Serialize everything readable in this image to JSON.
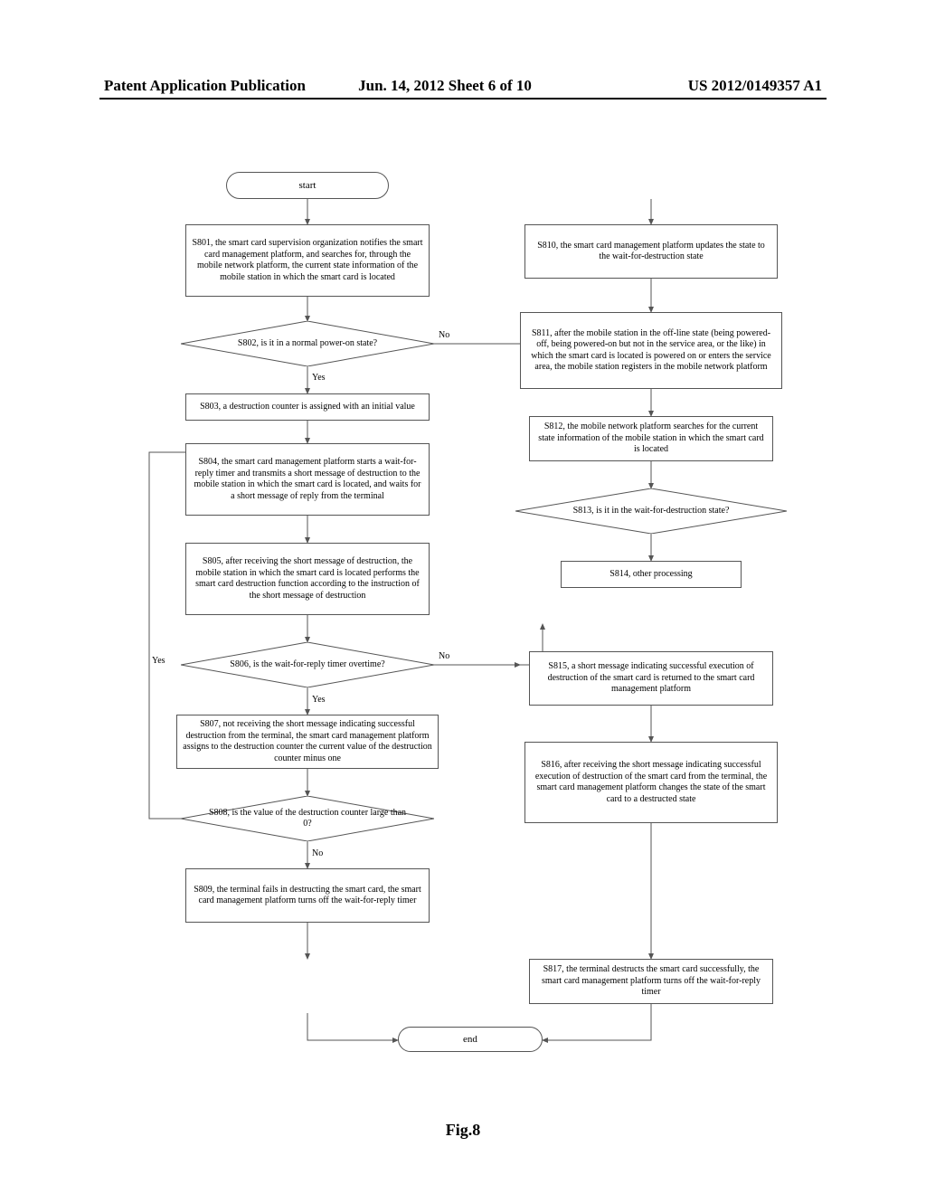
{
  "header": {
    "left": "Patent Application Publication",
    "center": "Jun. 14, 2012  Sheet 6 of 10",
    "right": "US 2012/0149357 A1"
  },
  "figure_label": "Fig.8",
  "nodes": {
    "start": "start",
    "end": "end",
    "s801": "S801, the smart card supervision organization notifies the smart card management platform, and searches for, through the mobile network platform, the current state information of the mobile station in which the smart card is located",
    "s802": "S802, is it in a normal power-on state?",
    "s803": "S803, a destruction counter is assigned with an initial value",
    "s804": "S804, the smart card management platform starts a wait-for-reply timer and transmits a short message of destruction to the mobile station in which the smart card is located, and waits for a short message of reply from the terminal",
    "s805": "S805, after receiving the short message of destruction, the mobile station in which the smart card is located performs the smart card destruction function according to the instruction of the short message of destruction",
    "s806": "S806, is the wait-for-reply timer overtime?",
    "s807": "S807, not receiving the short message indicating successful destruction from the terminal, the smart card management platform assigns to the destruction counter the current value of the destruction counter minus one",
    "s808": "S808, is the value of the destruction counter large than 0?",
    "s809": "S809, the terminal fails in destructing the smart card, the smart card management platform turns off the wait-for-reply timer",
    "s810": "S810, the smart card management platform updates the state to the wait-for-destruction state",
    "s811": "S811, after the mobile station in the off-line state (being powered-off, being powered-on but not in the service area, or the like) in which the smart card is located is powered on or enters the service area, the mobile station registers in the mobile network platform",
    "s812": "S812, the mobile network platform searches for the current state information of the mobile station in which the smart card is located",
    "s813": "S813, is it in the wait-for-destruction state?",
    "s814": "S814, other processing",
    "s815": "S815, a short message indicating successful execution of destruction of the smart card is returned to the smart card management platform",
    "s816": "S816, after receiving the short message indicating successful execution of destruction of the smart card from the terminal, the smart card management platform changes the state of the smart card to a destructed state",
    "s817": "S817, the terminal destructs the smart card successfully, the smart card management platform turns off the wait-for-reply timer"
  },
  "labels": {
    "yes": "Yes",
    "no": "No"
  },
  "chart_data": {
    "type": "flowchart",
    "nodes": [
      {
        "id": "start",
        "type": "terminator",
        "text_ref": "nodes.start"
      },
      {
        "id": "s801",
        "type": "process",
        "text_ref": "nodes.s801"
      },
      {
        "id": "s802",
        "type": "decision",
        "text_ref": "nodes.s802"
      },
      {
        "id": "s803",
        "type": "process",
        "text_ref": "nodes.s803"
      },
      {
        "id": "s804",
        "type": "process",
        "text_ref": "nodes.s804"
      },
      {
        "id": "s805",
        "type": "process",
        "text_ref": "nodes.s805"
      },
      {
        "id": "s806",
        "type": "decision",
        "text_ref": "nodes.s806"
      },
      {
        "id": "s807",
        "type": "process",
        "text_ref": "nodes.s807"
      },
      {
        "id": "s808",
        "type": "decision",
        "text_ref": "nodes.s808"
      },
      {
        "id": "s809",
        "type": "process",
        "text_ref": "nodes.s809"
      },
      {
        "id": "s810",
        "type": "process",
        "text_ref": "nodes.s810"
      },
      {
        "id": "s811",
        "type": "process",
        "text_ref": "nodes.s811"
      },
      {
        "id": "s812",
        "type": "process",
        "text_ref": "nodes.s812"
      },
      {
        "id": "s813",
        "type": "decision",
        "text_ref": "nodes.s813"
      },
      {
        "id": "s814",
        "type": "process",
        "text_ref": "nodes.s814"
      },
      {
        "id": "s815",
        "type": "process",
        "text_ref": "nodes.s815"
      },
      {
        "id": "s816",
        "type": "process",
        "text_ref": "nodes.s816"
      },
      {
        "id": "s817",
        "type": "process",
        "text_ref": "nodes.s817"
      },
      {
        "id": "end",
        "type": "terminator",
        "text_ref": "nodes.end"
      }
    ],
    "edges": [
      {
        "from": "start",
        "to": "s801"
      },
      {
        "from": "s801",
        "to": "s802"
      },
      {
        "from": "s802",
        "to": "s803",
        "label": "Yes"
      },
      {
        "from": "s802",
        "to": "s810",
        "label": "No"
      },
      {
        "from": "s803",
        "to": "s804"
      },
      {
        "from": "s804",
        "to": "s805"
      },
      {
        "from": "s805",
        "to": "s806"
      },
      {
        "from": "s806",
        "to": "s807",
        "label": "Yes"
      },
      {
        "from": "s806",
        "to": "s815",
        "label": "No"
      },
      {
        "from": "s807",
        "to": "s808"
      },
      {
        "from": "s808",
        "to": "s804",
        "label": "Yes"
      },
      {
        "from": "s808",
        "to": "s809",
        "label": "No"
      },
      {
        "from": "s809",
        "to": "end"
      },
      {
        "from": "s810",
        "to": "s811"
      },
      {
        "from": "s811",
        "to": "s812"
      },
      {
        "from": "s812",
        "to": "s813"
      },
      {
        "from": "s813",
        "to": "s814"
      },
      {
        "from": "s815",
        "to": "s816"
      },
      {
        "from": "s816",
        "to": "s817"
      },
      {
        "from": "s817",
        "to": "end"
      }
    ]
  }
}
